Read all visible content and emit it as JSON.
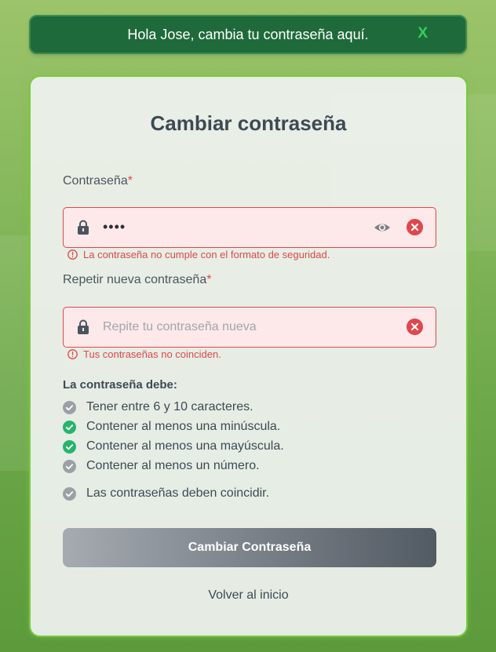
{
  "banner": {
    "message": "Hola Jose, cambia tu contraseña aquí.",
    "close_label": "X"
  },
  "form": {
    "title": "Cambiar contraseña",
    "password": {
      "label": "Contraseña",
      "required_mark": "*",
      "value": "••••",
      "error": "La contraseña no cumple con el formato de seguridad."
    },
    "repeat": {
      "label": "Repetir nueva contraseña",
      "required_mark": "*",
      "placeholder": "Repite tu contraseña nueva",
      "error": "Tus contraseñas no coinciden."
    },
    "rules_title": "La contraseña debe:",
    "rules": [
      {
        "text": "Tener entre 6 y 10 caracteres.",
        "met": false
      },
      {
        "text": "Contener al menos una minúscula.",
        "met": true
      },
      {
        "text": "Contener al menos una mayúscula.",
        "met": true
      },
      {
        "text": "Contener al menos un número.",
        "met": false
      },
      {
        "text": "Las contraseñas deben coincidir.",
        "met": false
      }
    ],
    "submit_label": "Cambiar Contraseña",
    "back_label": "Volver al inicio"
  },
  "colors": {
    "banner_bg": "#1f6a3a",
    "close": "#34d058",
    "error": "#e0474c",
    "rule_met": "#27b46b",
    "rule_unmet": "#9aa0a6",
    "card_border": "#7ac943"
  }
}
